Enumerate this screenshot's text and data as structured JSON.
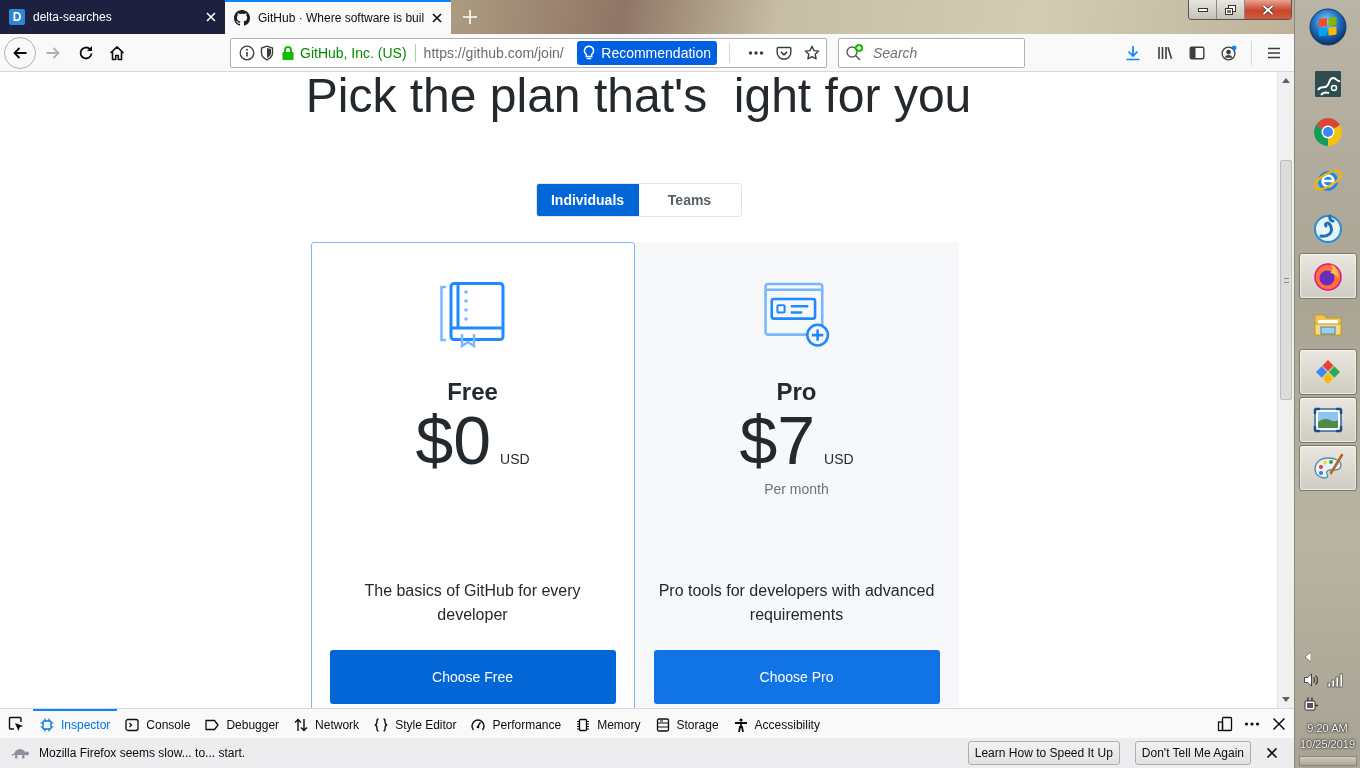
{
  "title_bar": {
    "tabs": [
      {
        "kind": "letter",
        "favicon_letter": "D",
        "title": "delta-searches",
        "selected": false
      },
      {
        "kind": "cat",
        "title": "GitHub · Where software is buil",
        "selected": true
      }
    ]
  },
  "nav_buttons": [
    {
      "kind": "back",
      "disabled": false
    },
    {
      "kind": "forward",
      "disabled": true
    },
    {
      "kind": "reload",
      "disabled": false
    },
    {
      "kind": "home",
      "disabled": false
    }
  ],
  "address_bar": {
    "identity": "GitHub, Inc. (US)",
    "url": "https://github.com/join/",
    "recommendation": "Recommendation"
  },
  "search": {
    "placeholder": "Search"
  },
  "page": {
    "heading": "Pick the plan that's  ight for you",
    "toggle": [
      {
        "label": "Individuals",
        "selected": true
      },
      {
        "label": "Teams",
        "selected": false
      }
    ],
    "plans": [
      {
        "kind": "book",
        "name": "Free",
        "price": "$0",
        "currency": "USD",
        "description": "The basics of GitHub for every developer",
        "button": "Choose Free",
        "selected": true
      },
      {
        "kind": "card",
        "name": "Pro",
        "price": "$7",
        "currency": "USD",
        "period": "Per month",
        "description": "Pro tools for developers with advanced requirements",
        "button": "Choose Pro",
        "selected": false
      }
    ]
  },
  "devtools": {
    "tabs": [
      {
        "kind": "inspector",
        "label": "Inspector",
        "selected": true
      },
      {
        "kind": "console",
        "label": "Console",
        "selected": false
      },
      {
        "kind": "debugger",
        "label": "Debugger",
        "selected": false
      },
      {
        "kind": "network",
        "label": "Network",
        "selected": false
      },
      {
        "kind": "style",
        "label": "Style Editor",
        "selected": false
      },
      {
        "kind": "performance",
        "label": "Performance",
        "selected": false
      },
      {
        "kind": "memory",
        "label": "Memory",
        "selected": false
      },
      {
        "kind": "storage",
        "label": "Storage",
        "selected": false
      },
      {
        "kind": "accessibility",
        "label": "Accessibility",
        "selected": false
      }
    ]
  },
  "notification": {
    "message": "Mozilla Firefox seems slow... to... start.",
    "buttons": [
      "Learn How to Speed It Up",
      "Don't Tell Me Again"
    ]
  },
  "taskbar": {
    "apps": [
      {
        "kind": "tile",
        "running": false
      },
      {
        "kind": "ring",
        "running": false
      },
      {
        "kind": "orbit",
        "running": false
      },
      {
        "kind": "swirl",
        "running": false
      },
      {
        "kind": "flame",
        "running": true
      },
      {
        "kind": "folder",
        "running": false
      },
      {
        "kind": "diamond",
        "running": true
      },
      {
        "kind": "picture",
        "running": true
      },
      {
        "kind": "palette",
        "running": true
      }
    ],
    "time": "9:20 AM",
    "date": "10/25/2019"
  }
}
